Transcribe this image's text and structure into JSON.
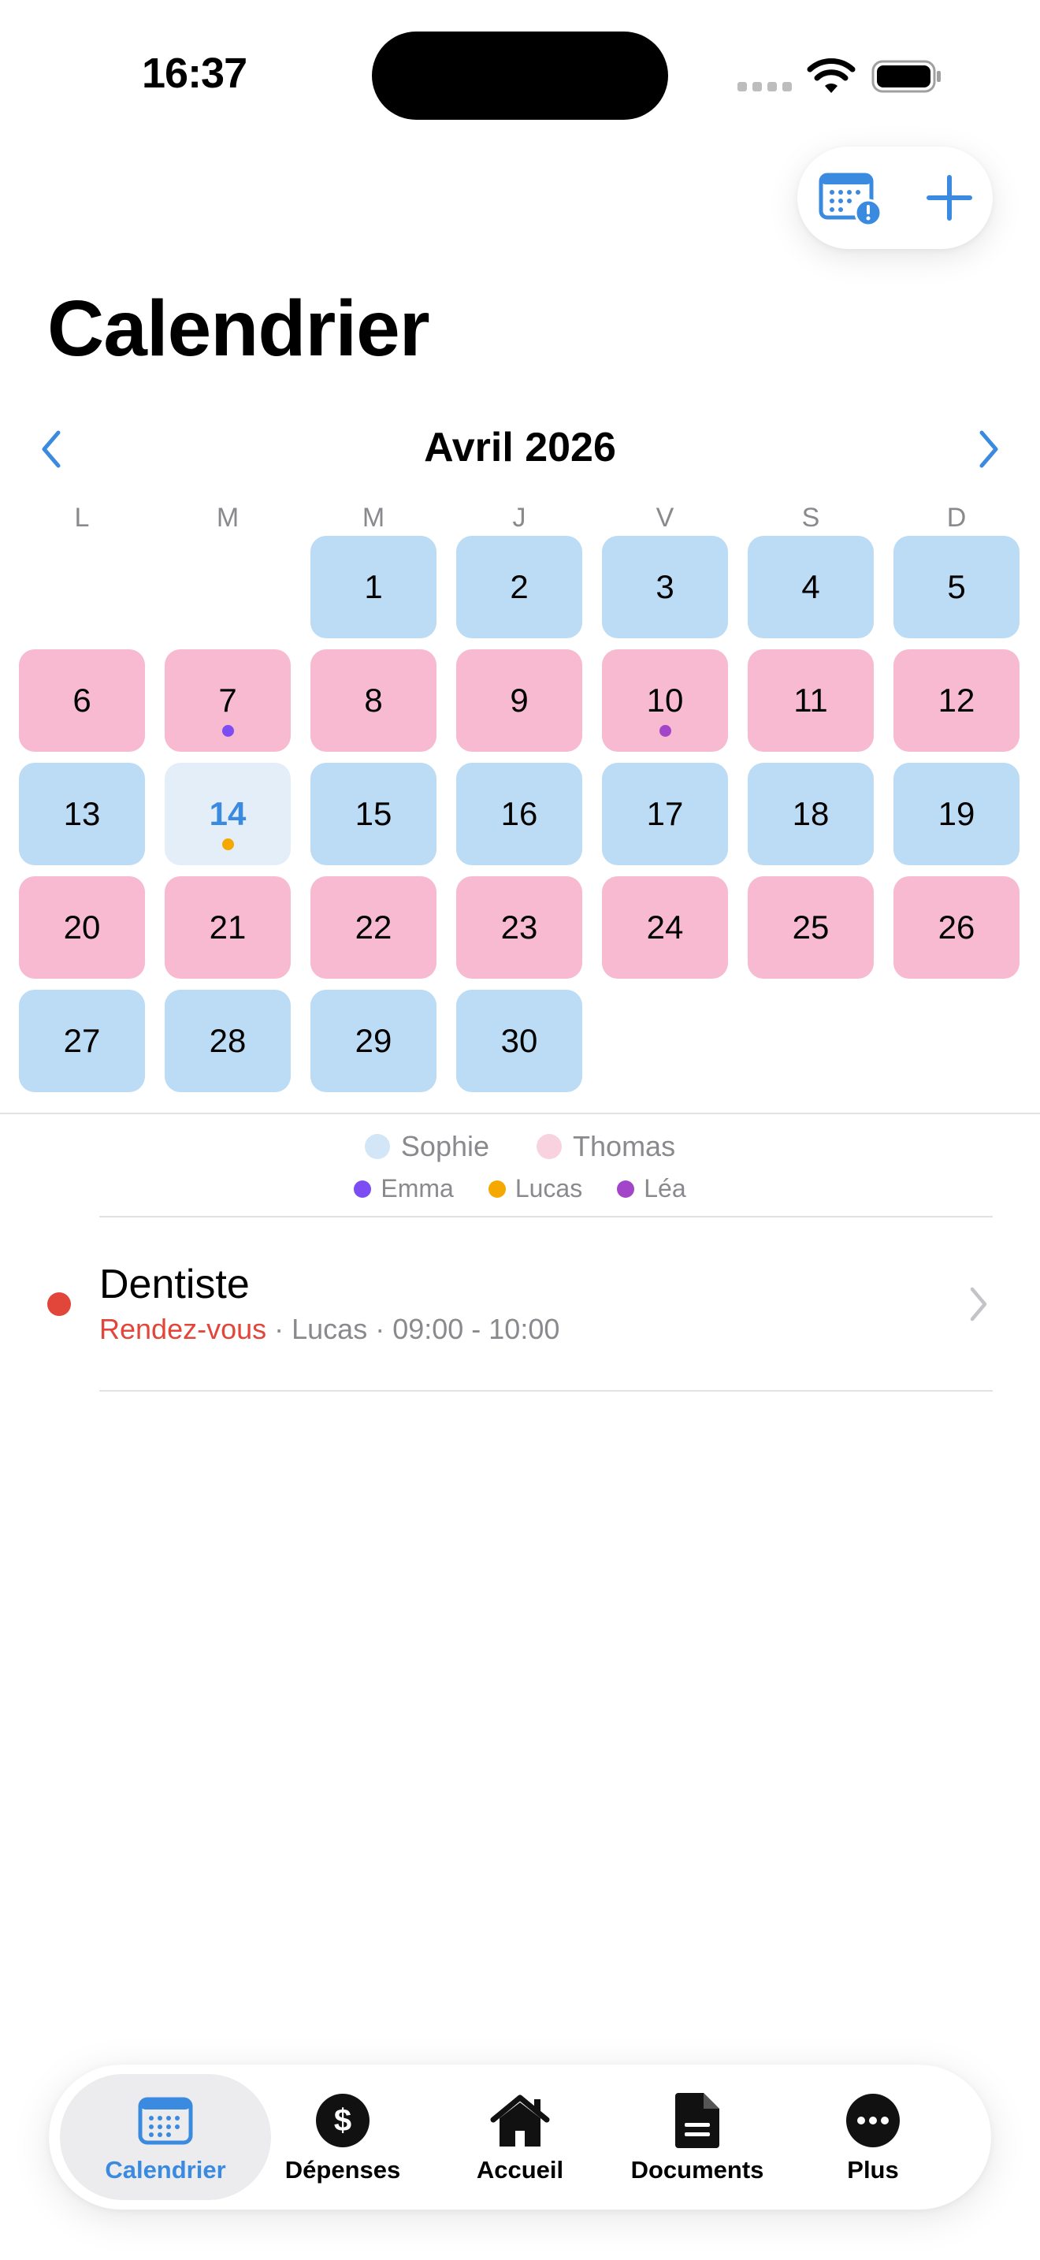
{
  "status_bar": {
    "time": "16:37"
  },
  "header": {
    "title": "Calendrier"
  },
  "month_nav": {
    "label": "Avril 2026"
  },
  "weekdays": [
    "L",
    "M",
    "M",
    "J",
    "V",
    "S",
    "D"
  ],
  "calendar": {
    "leading_blanks": 2,
    "today": 14,
    "days": [
      {
        "n": "1",
        "owner": "sophie"
      },
      {
        "n": "2",
        "owner": "sophie"
      },
      {
        "n": "3",
        "owner": "sophie"
      },
      {
        "n": "4",
        "owner": "sophie"
      },
      {
        "n": "5",
        "owner": "sophie"
      },
      {
        "n": "6",
        "owner": "thomas"
      },
      {
        "n": "7",
        "owner": "thomas",
        "dot": "#7c4df2"
      },
      {
        "n": "8",
        "owner": "thomas"
      },
      {
        "n": "9",
        "owner": "thomas"
      },
      {
        "n": "10",
        "owner": "thomas",
        "dot": "#a345c9"
      },
      {
        "n": "11",
        "owner": "thomas"
      },
      {
        "n": "12",
        "owner": "thomas"
      },
      {
        "n": "13",
        "owner": "sophie"
      },
      {
        "n": "14",
        "owner": "today",
        "dot": "#f5a800"
      },
      {
        "n": "15",
        "owner": "sophie"
      },
      {
        "n": "16",
        "owner": "sophie"
      },
      {
        "n": "17",
        "owner": "sophie"
      },
      {
        "n": "18",
        "owner": "sophie"
      },
      {
        "n": "19",
        "owner": "sophie"
      },
      {
        "n": "20",
        "owner": "thomas"
      },
      {
        "n": "21",
        "owner": "thomas"
      },
      {
        "n": "22",
        "owner": "thomas"
      },
      {
        "n": "23",
        "owner": "thomas"
      },
      {
        "n": "24",
        "owner": "thomas"
      },
      {
        "n": "25",
        "owner": "thomas"
      },
      {
        "n": "26",
        "owner": "thomas"
      },
      {
        "n": "27",
        "owner": "sophie"
      },
      {
        "n": "28",
        "owner": "sophie"
      },
      {
        "n": "29",
        "owner": "sophie"
      },
      {
        "n": "30",
        "owner": "sophie"
      }
    ]
  },
  "legend": {
    "parents": [
      {
        "name": "Sophie",
        "color": "#d3e6f8"
      },
      {
        "name": "Thomas",
        "color": "#f8d3df"
      }
    ],
    "children": [
      {
        "name": "Emma",
        "color": "#7c4df2"
      },
      {
        "name": "Lucas",
        "color": "#f5a800"
      },
      {
        "name": "Léa",
        "color": "#a345c9"
      }
    ]
  },
  "event": {
    "title": "Dentiste",
    "type": "Rendez-vous",
    "person": "· Lucas",
    "time": "· 09:00 - 10:00",
    "color": "#e2453a"
  },
  "tabs": [
    {
      "label": "Calendrier",
      "icon": "calendar-icon",
      "active": true
    },
    {
      "label": "Dépenses",
      "icon": "dollar-icon"
    },
    {
      "label": "Accueil",
      "icon": "home-icon"
    },
    {
      "label": "Documents",
      "icon": "document-icon"
    },
    {
      "label": "Plus",
      "icon": "more-icon"
    }
  ],
  "colors": {
    "accent": "#3a8ae0",
    "sophie": "#bcdcf6",
    "thomas": "#f7bad0",
    "today": "#e4eef9"
  }
}
